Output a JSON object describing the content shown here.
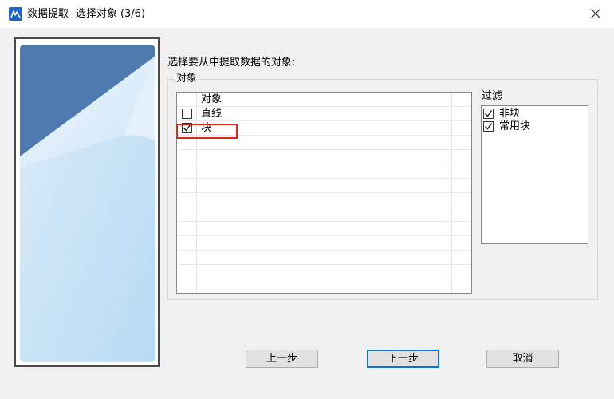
{
  "window": {
    "title": "数据提取 -选择对象 (3/6)",
    "accent_color": "#0078d7",
    "icons": {
      "app": "data-extraction-app-icon",
      "close": "close-icon"
    }
  },
  "main": {
    "instruction": "选择要从中提取数据的对象:",
    "object_group": {
      "legend": "对象",
      "list": {
        "header": "对象",
        "items": [
          {
            "label": "直线",
            "checked": false
          },
          {
            "label": "块",
            "checked": true
          }
        ]
      }
    },
    "filter": {
      "label": "过滤",
      "items": [
        {
          "label": "非块",
          "checked": true
        },
        {
          "label": "常用块",
          "checked": true
        }
      ]
    }
  },
  "buttons": {
    "prev": "上一步",
    "next": "下一步",
    "cancel": "取消"
  },
  "annotation": {
    "highlight_color": "#e0261c"
  }
}
